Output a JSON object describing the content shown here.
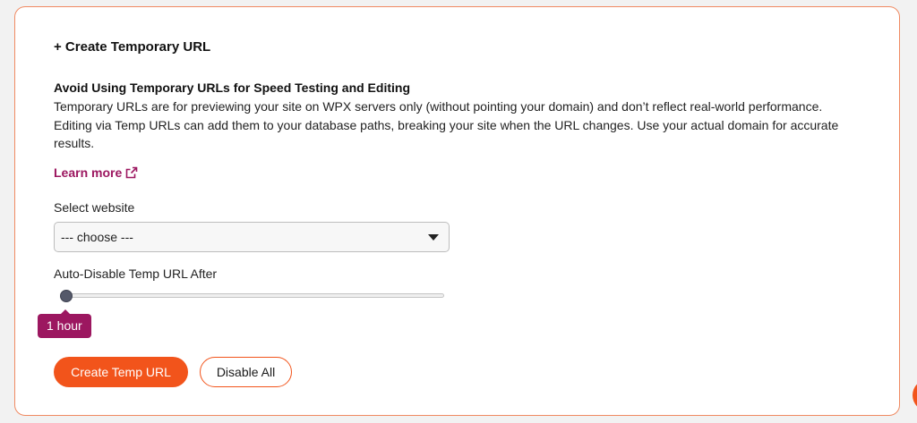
{
  "card": {
    "title": "+ Create Temporary URL",
    "warning_heading": "Avoid Using Temporary URLs for Speed Testing and Editing",
    "warning_body": "Temporary URLs are for previewing your site on WPX servers only (without pointing your domain) and don’t reflect real-world performance. Editing via Temp URLs can add them to your database paths, breaking your site when the URL changes. Use your actual domain for accurate results.",
    "learn_more": "Learn more",
    "learn_more_icon": "external-link-icon"
  },
  "select_website": {
    "label": "Select website",
    "selected": "--- choose ---",
    "caret_icon": "caret-down-icon"
  },
  "auto_disable": {
    "label": "Auto-Disable Temp URL After",
    "value_fraction": 0.0,
    "tooltip": "1 hour"
  },
  "buttons": {
    "create": "Create Temp URL",
    "disable_all": "Disable All"
  },
  "colors": {
    "accent": "#f2541b",
    "link": "#9c1760",
    "tooltip": "#9c1760",
    "card_border": "#f08a62"
  },
  "chat_widget_icon": "chat-bubble-icon"
}
